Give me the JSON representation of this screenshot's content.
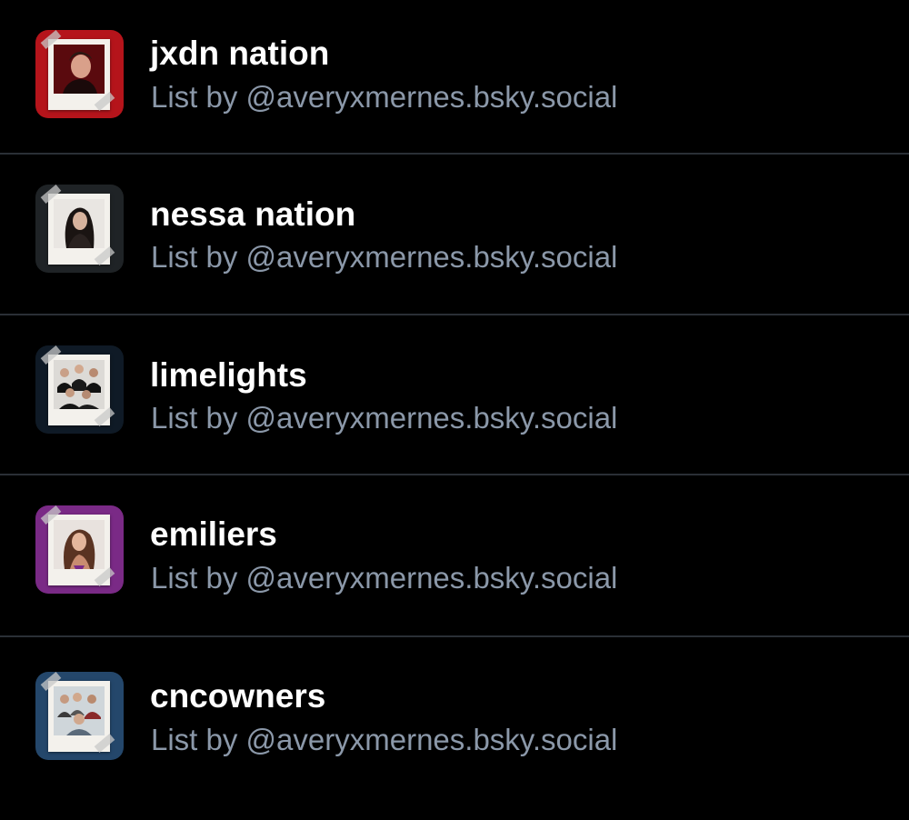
{
  "lists": [
    {
      "title": "jxdn nation",
      "subtitle": "List by @averyxmernes.bsky.social",
      "avatar_icon": "polaroid-portrait-icon",
      "avatar_bg": "#b5141b"
    },
    {
      "title": "nessa nation",
      "subtitle": "List by @averyxmernes.bsky.social",
      "avatar_icon": "polaroid-portrait-icon",
      "avatar_bg": "#1f2326"
    },
    {
      "title": "limelights",
      "subtitle": "List by @averyxmernes.bsky.social",
      "avatar_icon": "polaroid-group-icon",
      "avatar_bg": "#0f1a26"
    },
    {
      "title": "emiliers",
      "subtitle": "List by @averyxmernes.bsky.social",
      "avatar_icon": "polaroid-portrait-icon",
      "avatar_bg": "#7a2a86"
    },
    {
      "title": "cncowners",
      "subtitle": "List by @averyxmernes.bsky.social",
      "avatar_icon": "polaroid-group-icon",
      "avatar_bg": "#24476b"
    }
  ],
  "colors": {
    "background": "#000000",
    "title": "#ffffff",
    "subtitle": "#8b98a9",
    "divider": "#2a2f36"
  }
}
